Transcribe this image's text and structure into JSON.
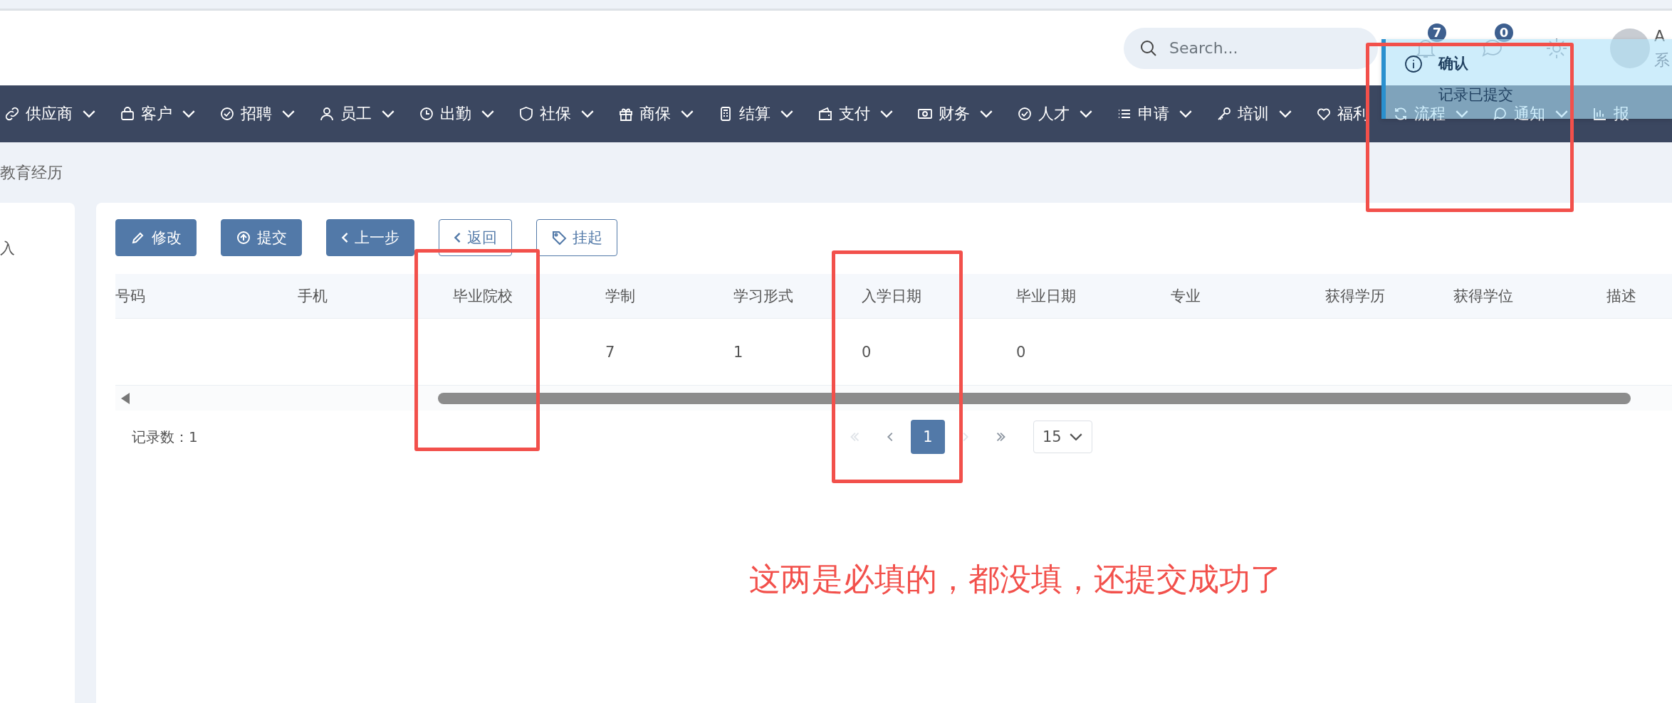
{
  "header": {
    "search": {
      "placeholder": "Search..."
    },
    "notifications": {
      "badge": "7"
    },
    "messages": {
      "badge": "0"
    },
    "user": {
      "name": "A",
      "role": "系"
    }
  },
  "nav": [
    {
      "label": "供应商",
      "dropdown": true
    },
    {
      "label": "客户",
      "dropdown": true
    },
    {
      "label": "招聘",
      "dropdown": true
    },
    {
      "label": "员工",
      "dropdown": true
    },
    {
      "label": "出勤",
      "dropdown": true
    },
    {
      "label": "社保",
      "dropdown": true
    },
    {
      "label": "商保",
      "dropdown": true
    },
    {
      "label": "结算",
      "dropdown": true
    },
    {
      "label": "支付",
      "dropdown": true
    },
    {
      "label": "财务",
      "dropdown": true
    },
    {
      "label": "人才",
      "dropdown": true
    },
    {
      "label": "申请",
      "dropdown": true
    },
    {
      "label": "培训",
      "dropdown": true
    },
    {
      "label": "福利",
      "dropdown": false
    },
    {
      "label": "流程",
      "dropdown": true
    },
    {
      "label": "通知",
      "dropdown": true
    },
    {
      "label": "报",
      "dropdown": false
    }
  ],
  "breadcrumb": "教育经历",
  "side_panel": {
    "item": "入"
  },
  "toolbar": [
    {
      "label": "修改",
      "kind": "primary"
    },
    {
      "label": "提交",
      "kind": "primary"
    },
    {
      "label": "上一步",
      "kind": "primary"
    },
    {
      "label": "返回",
      "kind": "outline"
    },
    {
      "label": "挂起",
      "kind": "outline"
    }
  ],
  "table": {
    "columns": [
      "号码",
      "手机",
      "毕业院校",
      "学制",
      "学习形式",
      "入学日期",
      "毕业日期",
      "专业",
      "获得学历",
      "获得学位",
      "描述"
    ],
    "rows": [
      [
        null,
        null,
        null,
        "7",
        "1",
        "0",
        "0",
        null,
        null,
        null,
        null
      ]
    ]
  },
  "footer": {
    "record_count": "记录数：1",
    "first_disabled": true,
    "prev_disabled": false,
    "next_disabled": true,
    "last_disabled": false,
    "pages": [
      {
        "label": "1",
        "selected": true
      }
    ],
    "page_size": "15"
  },
  "toast": {
    "title": "确认",
    "message": "记录已提交"
  },
  "annotation": {
    "text": "这两是必填的，都没填，还提交成功了"
  }
}
